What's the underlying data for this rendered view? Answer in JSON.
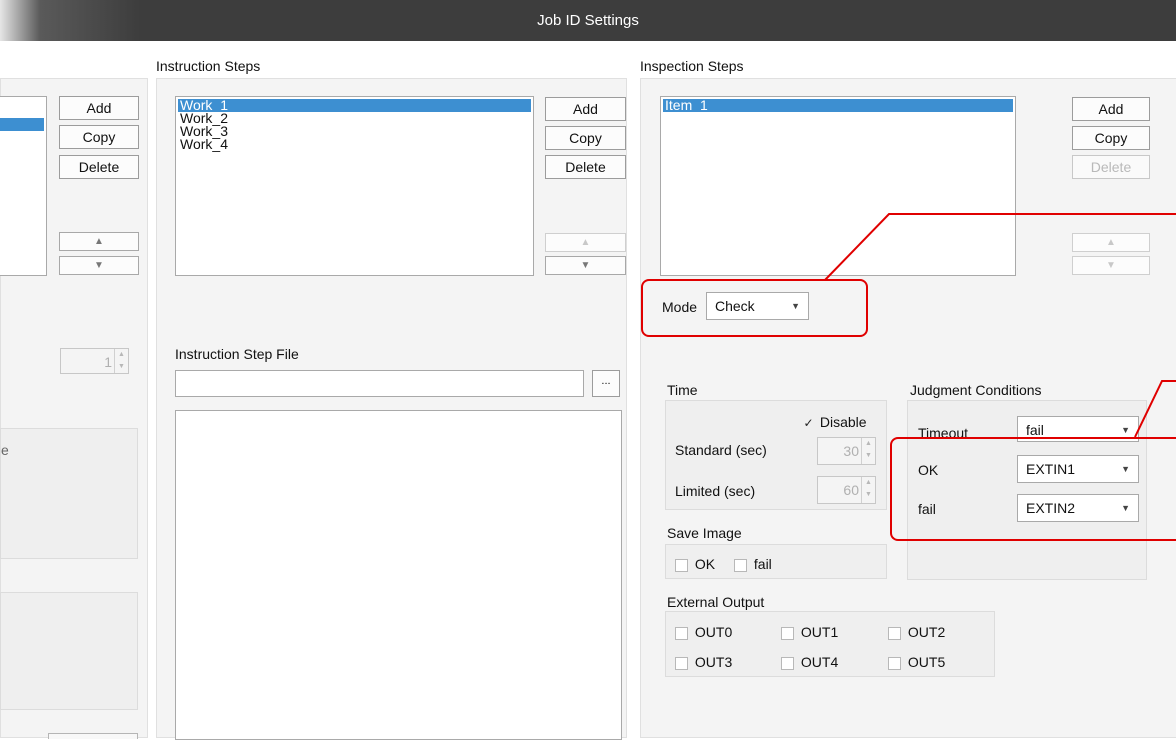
{
  "window": {
    "title": "Job ID Settings"
  },
  "left_column": {
    "buttons": {
      "add": "Add",
      "copy": "Copy",
      "delete": "Delete"
    },
    "arrows": {
      "up": "▲",
      "down": "▼"
    },
    "spin_value": "1",
    "partial_label": "e"
  },
  "instruction_steps": {
    "header": "Instruction Steps",
    "items": [
      "Work_1",
      "Work_2",
      "Work_3",
      "Work_4"
    ],
    "selected_index": 0,
    "buttons": {
      "add": "Add",
      "copy": "Copy",
      "delete": "Delete"
    },
    "arrows": {
      "up": "▲",
      "down": "▼"
    },
    "file": {
      "label": "Instruction Step File",
      "value": "",
      "browse_label": "..."
    }
  },
  "inspection_steps": {
    "header": "Inspection Steps",
    "items": [
      "Item_1"
    ],
    "selected_index": 0,
    "buttons": {
      "add": "Add",
      "copy": "Copy",
      "delete": "Delete"
    },
    "arrows": {
      "up": "▲",
      "down": "▼"
    },
    "mode": {
      "label": "Mode",
      "value": "Check"
    },
    "time": {
      "label": "Time",
      "disable_label": "Disable",
      "disable_checked": true,
      "standard_label": "Standard (sec)",
      "standard_value": "30",
      "limited_label": "Limited (sec)",
      "limited_value": "60"
    },
    "judgment": {
      "label": "Judgment Conditions",
      "timeout_label": "Timeout",
      "timeout_value": "fail",
      "ok_label": "OK",
      "ok_value": "EXTIN1",
      "fail_label": "fail",
      "fail_value": "EXTIN2"
    },
    "save_image": {
      "label": "Save Image",
      "ok_label": "OK",
      "fail_label": "fail"
    },
    "external_output": {
      "label": "External Output",
      "outputs": [
        "OUT0",
        "OUT1",
        "OUT2",
        "OUT3",
        "OUT4",
        "OUT5"
      ]
    }
  },
  "colors": {
    "highlight": "#e00000",
    "selection": "#3d8fd1",
    "titlebar": "#3d3d3d"
  }
}
